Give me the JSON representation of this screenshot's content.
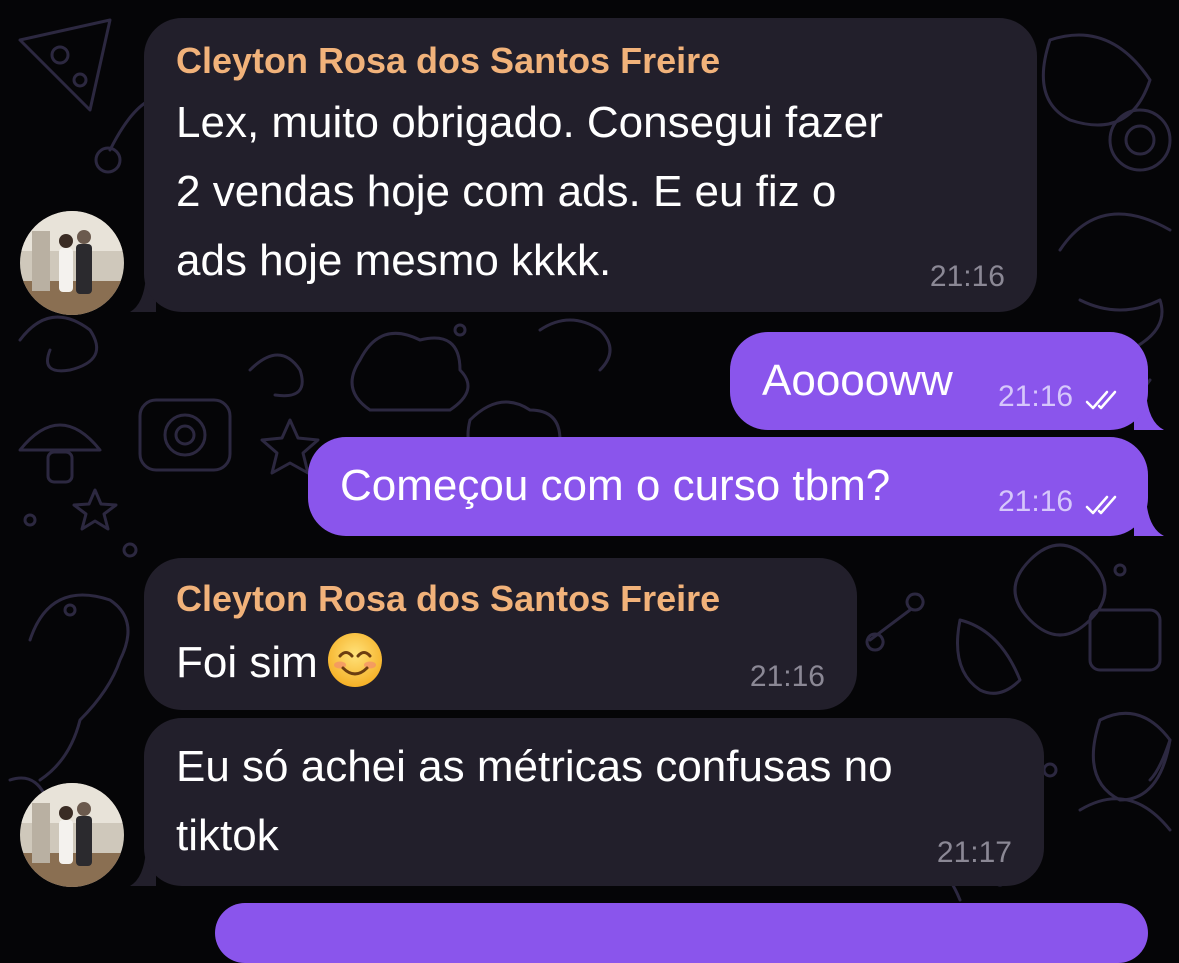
{
  "chat": {
    "messages": [
      {
        "direction": "incoming",
        "sender": "Cleyton Rosa dos Santos Freire",
        "lines": [
          "Lex, muito obrigado. Consegui fazer",
          "2 vendas hoje com ads. E eu fiz o",
          "ads hoje mesmo kkkk."
        ],
        "time": "21:16"
      },
      {
        "direction": "outgoing",
        "text": "Aooooww",
        "time": "21:16",
        "status": "read"
      },
      {
        "direction": "outgoing",
        "text": "Começou com o curso tbm?",
        "time": "21:16",
        "status": "read"
      },
      {
        "direction": "incoming",
        "sender": "Cleyton Rosa dos Santos Freire",
        "text": "Foi sim",
        "emoji_icon": "smiling-face-icon",
        "time": "21:16"
      },
      {
        "direction": "incoming",
        "lines": [
          "Eu só achei as métricas confusas no",
          "tiktok"
        ],
        "time": "21:17"
      }
    ]
  },
  "colors": {
    "background": "#050507",
    "incoming_bubble": "#221f2b",
    "outgoing_bubble": "#8a55ec",
    "sender_name": "#f1b27a",
    "text": "#ffffff",
    "incoming_time": "#8b8895",
    "outgoing_time": "#d6c7fb"
  }
}
